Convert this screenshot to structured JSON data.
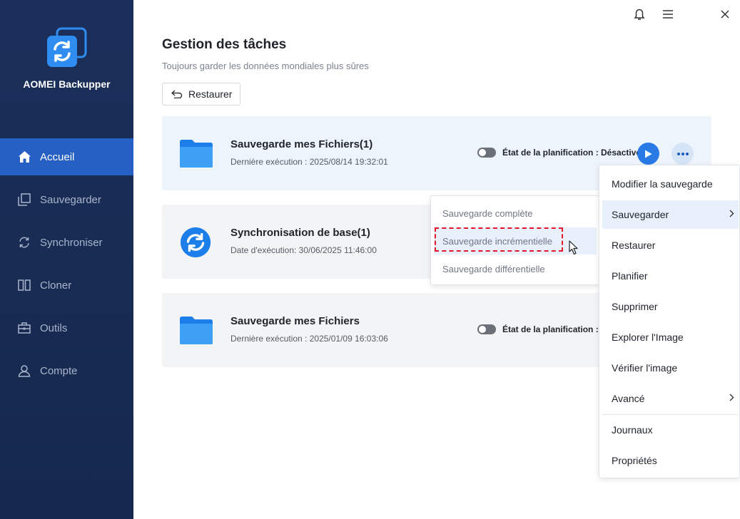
{
  "app": {
    "name": "AOMEI Backupper"
  },
  "sidebar": {
    "items": [
      {
        "label": "Accueil",
        "icon": "home-icon",
        "active": true
      },
      {
        "label": "Sauvegarder",
        "icon": "backup-icon"
      },
      {
        "label": "Synchroniser",
        "icon": "sync-icon"
      },
      {
        "label": "Cloner",
        "icon": "clone-icon"
      },
      {
        "label": "Outils",
        "icon": "toolbox-icon"
      },
      {
        "label": "Compte",
        "icon": "user-icon"
      }
    ]
  },
  "window_controls": [
    "bell-icon",
    "menu-icon",
    "close-icon"
  ],
  "header": {
    "title": "Gestion des tâches",
    "subtitle": "Toujours garder les données mondiales plus sûres",
    "restore_label": "Restaurer"
  },
  "tasks": [
    {
      "name": "Sauvegarde mes Fichiers(1)",
      "date": "Dernière exécution : 2025/08/14 19:32:01",
      "schedule": "État de la planification : Désactivé",
      "icon": "folder-icon"
    },
    {
      "name": "Synchronisation de base(1)",
      "date": "Date d'exécution: 30/06/2025 11:46:00",
      "icon": "sync-circle-icon"
    },
    {
      "name": "Sauvegarde mes Fichiers",
      "date": "Dernière exécution : 2025/01/09 16:03:06",
      "schedule": "État de la planification : De",
      "icon": "folder-icon"
    }
  ],
  "submenu": {
    "items": [
      "Sauvegarde complète",
      "Sauvegarde incrémentielle",
      "Sauvegarde différentielle"
    ],
    "hovered": "Sauvegarde incrémentielle"
  },
  "context_menu": {
    "items": [
      "Modifier la sauvegarde",
      "Sauvegarder",
      "Restaurer",
      "Planifier",
      "Supprimer",
      "Explorer l'Image",
      "Vérifier l'image",
      "Avancé",
      "Journaux",
      "Propriétés"
    ],
    "active": "Sauvegarder"
  },
  "colors": {
    "sidebar_bg": "#1a2f5a",
    "accent": "#2760c4",
    "play": "#2a7ae6",
    "highlight_dash": "#e1162a"
  }
}
